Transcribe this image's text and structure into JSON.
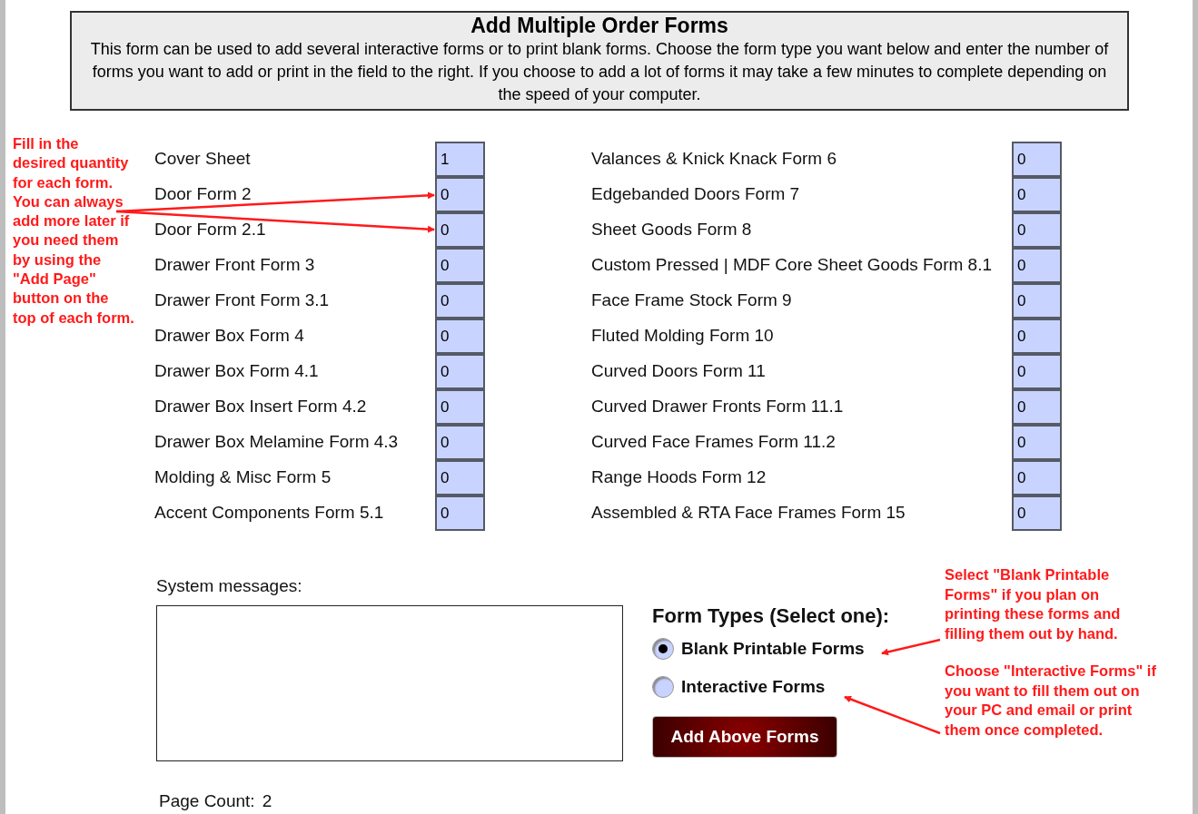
{
  "header": {
    "title": "Add Multiple Order Forms",
    "description": "This form can be used to add several interactive forms or to print blank forms.  Choose the form type you want below and enter the number of forms you want to add or print in the field to the right.  If you choose to add a lot of forms it may take a few minutes to complete depending on the speed of your computer."
  },
  "left_note": "Fill in the desired quantity for each form. You can always add more later if you need them by using the \"Add Page\" button on the top of each form.",
  "forms_left": [
    {
      "label": "Cover Sheet",
      "value": "1"
    },
    {
      "label": "Door Form 2",
      "value": "0"
    },
    {
      "label": "Door Form 2.1",
      "value": "0"
    },
    {
      "label": "Drawer Front Form 3",
      "value": "0"
    },
    {
      "label": "Drawer Front Form 3.1",
      "value": "0"
    },
    {
      "label": "Drawer Box Form 4",
      "value": "0"
    },
    {
      "label": "Drawer Box Form 4.1",
      "value": "0"
    },
    {
      "label": "Drawer Box Insert Form 4.2",
      "value": "0"
    },
    {
      "label": "Drawer Box Melamine Form 4.3",
      "value": "0"
    },
    {
      "label": "Molding & Misc Form 5",
      "value": "0"
    },
    {
      "label": "Accent Components Form 5.1",
      "value": "0"
    }
  ],
  "forms_right": [
    {
      "label": "Valances & Knick Knack Form 6",
      "value": "0"
    },
    {
      "label": "Edgebanded Doors Form 7",
      "value": "0"
    },
    {
      "label": "Sheet Goods Form 8",
      "value": "0"
    },
    {
      "label": "Custom Pressed | MDF Core Sheet Goods Form 8.1",
      "value": "0"
    },
    {
      "label": "Face Frame Stock Form 9",
      "value": "0"
    },
    {
      "label": "Fluted Molding Form 10",
      "value": "0"
    },
    {
      "label": "Curved Doors Form 11",
      "value": "0"
    },
    {
      "label": "Curved Drawer Fronts Form 11.1",
      "value": "0"
    },
    {
      "label": "Curved Face Frames Form 11.2",
      "value": "0"
    },
    {
      "label": "Range Hoods Form 12",
      "value": "0"
    },
    {
      "label": "Assembled & RTA Face Frames Form 15",
      "value": "0"
    }
  ],
  "system_messages": {
    "label": "System messages:"
  },
  "page_count": {
    "label": "Page Count:",
    "value": "2"
  },
  "form_types": {
    "title": "Form Types (Select one):",
    "options": [
      {
        "label": "Blank Printable Forms",
        "selected": true
      },
      {
        "label": "Interactive Forms",
        "selected": false
      }
    ]
  },
  "button": "Add Above Forms",
  "right_notes": [
    "Select \"Blank Printable Forms\" if you plan on printing these forms and filling them out by hand.",
    "Choose \"Interactive Forms\" if you want to fill them out on your PC and email or print them once completed."
  ]
}
